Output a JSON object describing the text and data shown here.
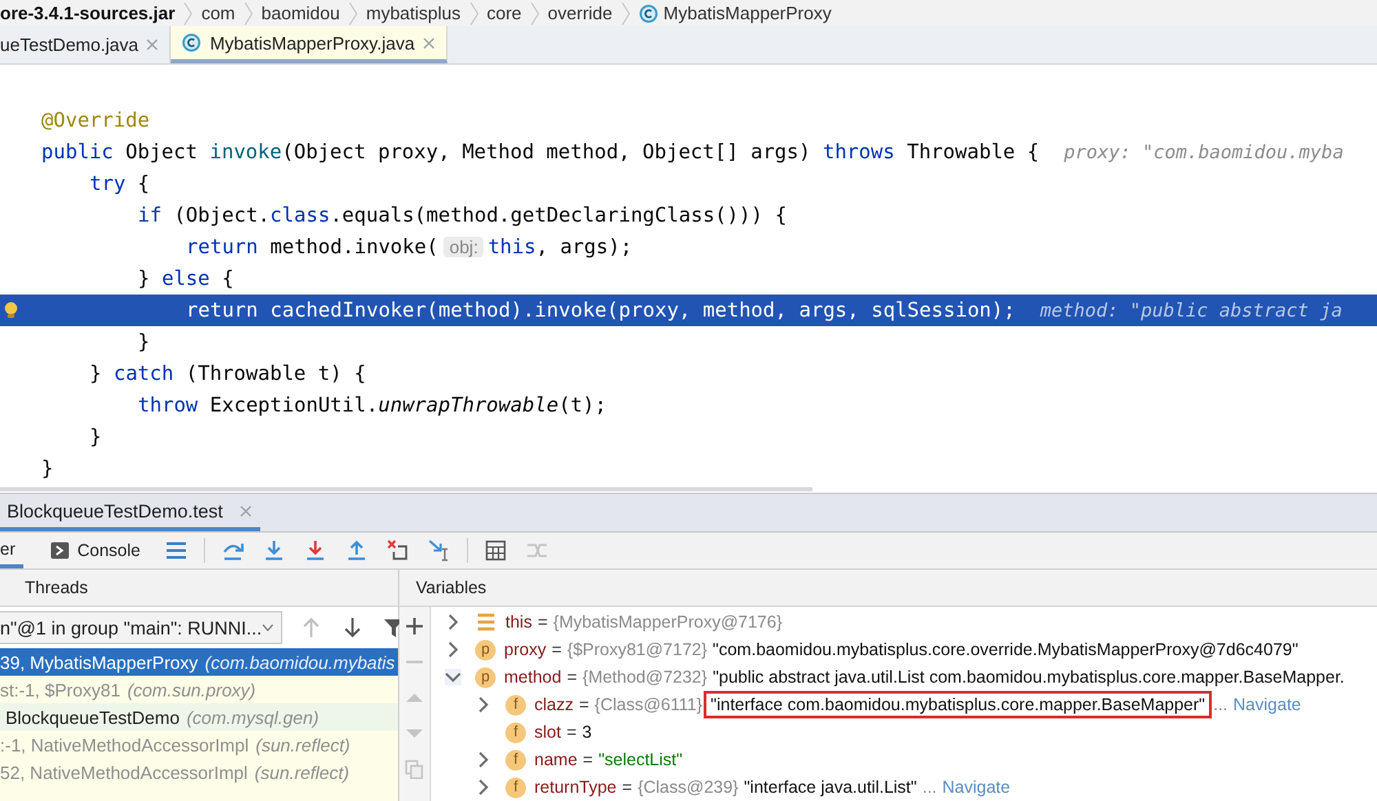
{
  "breadcrumb": [
    {
      "label": "ore-3.4.1-sources.jar",
      "kind": "jar"
    },
    {
      "label": "com",
      "kind": "package"
    },
    {
      "label": "baomidou",
      "kind": "package"
    },
    {
      "label": "mybatisplus",
      "kind": "package"
    },
    {
      "label": "core",
      "kind": "package"
    },
    {
      "label": "override",
      "kind": "package"
    },
    {
      "label": "MybatisMapperProxy",
      "kind": "class"
    }
  ],
  "editor_tabs": [
    {
      "label": "ueTestDemo.java",
      "selected": false,
      "kind": "plain"
    },
    {
      "label": "MybatisMapperProxy.java",
      "selected": true,
      "kind": "class"
    }
  ],
  "code_lines": [
    {
      "current": false,
      "segments": [
        {
          "kind": "annotation",
          "text": "@Override"
        }
      ]
    },
    {
      "current": false,
      "segments": [
        {
          "kind": "keyword",
          "text": "public"
        },
        {
          "kind": "plain",
          "text": " Object "
        },
        {
          "kind": "declaration",
          "text": "invoke"
        },
        {
          "kind": "plain",
          "text": "(Object proxy, Method method, Object[] args) "
        },
        {
          "kind": "keyword",
          "text": "throws"
        },
        {
          "kind": "plain",
          "text": " Throwable {"
        },
        {
          "kind": "debug_value",
          "text": "proxy: \"com.baomidou.myba"
        }
      ],
      "children": [
        {
          "current": false,
          "segments": [
            {
              "kind": "keyword",
              "text": "try"
            },
            {
              "kind": "plain",
              "text": " {"
            }
          ],
          "children": [
            {
              "current": false,
              "segments": [
                {
                  "kind": "keyword",
                  "text": "if"
                },
                {
                  "kind": "plain",
                  "text": " (Object."
                },
                {
                  "kind": "keyword",
                  "text": "class"
                },
                {
                  "kind": "plain",
                  "text": ".equals(method.getDeclaringClass())) {"
                }
              ],
              "children": [
                {
                  "current": false,
                  "segments": [
                    {
                      "kind": "keyword",
                      "text": "return"
                    },
                    {
                      "kind": "plain",
                      "text": " method.invoke("
                    },
                    {
                      "kind": "param_hint",
                      "text": "obj:"
                    },
                    {
                      "kind": "keyword",
                      "text": "this"
                    },
                    {
                      "kind": "plain",
                      "text": ", args);"
                    }
                  ]
                }
              ]
            },
            {
              "current": false,
              "segments": [
                {
                  "kind": "plain",
                  "text": "} "
                },
                {
                  "kind": "keyword",
                  "text": "else"
                },
                {
                  "kind": "plain",
                  "text": " {"
                }
              ],
              "children": [
                {
                  "current": true,
                  "segments": [
                    {
                      "kind": "keyword",
                      "text": "return"
                    },
                    {
                      "kind": "plain",
                      "text": " cachedInvoker(method).invoke(proxy, method, args, sqlSession);"
                    },
                    {
                      "kind": "debug_value",
                      "text": "method: \"public abstract ja"
                    }
                  ]
                }
              ]
            },
            {
              "current": false,
              "segments": [
                {
                  "kind": "plain",
                  "text": "}"
                }
              ]
            }
          ]
        },
        {
          "current": false,
          "segments": [
            {
              "kind": "plain",
              "text": "} "
            },
            {
              "kind": "keyword",
              "text": "catch"
            },
            {
              "kind": "plain",
              "text": " (Throwable t) {"
            }
          ],
          "children": [
            {
              "current": false,
              "segments": [
                {
                  "kind": "keyword",
                  "text": "throw"
                },
                {
                  "kind": "plain",
                  "text": " ExceptionUtil."
                },
                {
                  "kind": "italic",
                  "text": "unwrapThrowable"
                },
                {
                  "kind": "plain",
                  "text": "(t);"
                }
              ]
            }
          ]
        },
        {
          "current": false,
          "segments": [
            {
              "kind": "plain",
              "text": "}"
            }
          ]
        }
      ]
    },
    {
      "current": false,
      "segments": [
        {
          "kind": "plain",
          "text": "}"
        }
      ]
    }
  ],
  "debug_session_tab": {
    "label": "BlockqueueTestDemo.test",
    "selected": true
  },
  "debug_tabs": [
    {
      "label": "er",
      "selected": true,
      "kind": "plain"
    },
    {
      "label": "Console",
      "selected": false,
      "kind": "console"
    }
  ],
  "toolbar": [
    {
      "kind": "list"
    },
    {
      "kind": "separator"
    },
    {
      "kind": "step_over"
    },
    {
      "kind": "step_into"
    },
    {
      "kind": "force_step_into"
    },
    {
      "kind": "step_out"
    },
    {
      "kind": "drop_frame"
    },
    {
      "kind": "run_to_cursor"
    },
    {
      "kind": "separator"
    },
    {
      "kind": "evaluate"
    },
    {
      "kind": "trace"
    }
  ],
  "threads": {
    "title": "Threads",
    "selector": "n\"@1 in group \"main\": RUNNI...",
    "frames": [
      {
        "location": "39, MybatisMapperProxy",
        "package": "(com.baomidou.mybatis",
        "selected": true,
        "library": false
      },
      {
        "location": "st:-1, $Proxy81",
        "package": "(com.sun.proxy)",
        "selected": false,
        "library": true
      },
      {
        "location": "BlockqueueTestDemo",
        "package": "(com.mysql.gen)",
        "selected": false,
        "library": false
      },
      {
        "location": ":-1, NativeMethodAccessorImpl",
        "package": "(sun.reflect)",
        "selected": false,
        "library": true
      },
      {
        "location": "52, NativeMethodAccessorImpl",
        "package": "(sun.reflect)",
        "selected": false,
        "library": true
      }
    ]
  },
  "variables": {
    "title": "Variables",
    "items": [
      {
        "kind": "list",
        "name": "this",
        "operator": "=",
        "ref": "{MybatisMapperProxy@7176}",
        "expandable": true,
        "expanded": false
      },
      {
        "kind": "badge",
        "badge": "p",
        "name": "proxy",
        "operator": "=",
        "ref": "{$Proxy81@7172}",
        "value": "\"com.baomidou.mybatisplus.core.override.MybatisMapperProxy@7d6c4079\"",
        "string_value": false,
        "expandable": true,
        "expanded": false
      },
      {
        "kind": "badge",
        "badge": "p",
        "name": "method",
        "operator": "=",
        "ref": "{Method@7232}",
        "value": "\"public abstract java.util.List com.baomidou.mybatisplus.core.mapper.BaseMapper.",
        "string_value": false,
        "expandable": true,
        "expanded": true,
        "children": [
          {
            "kind": "badge",
            "badge": "f",
            "name": "clazz",
            "operator": "=",
            "ref": "{Class@6111}",
            "value": "\"interface com.baomidou.mybatisplus.core.mapper.BaseMapper\"",
            "string_value": false,
            "marked": true,
            "more": "...",
            "link": "Navigate",
            "expandable": true
          },
          {
            "kind": "badge",
            "badge": "f",
            "name": "slot",
            "operator": "=",
            "value": "3",
            "string_value": false,
            "expandable": false
          },
          {
            "kind": "badge",
            "badge": "f",
            "name": "name",
            "operator": "=",
            "value": "\"selectList\"",
            "string_value": true,
            "expandable": true
          },
          {
            "kind": "badge",
            "badge": "f",
            "name": "returnType",
            "operator": "=",
            "ref": "{Class@239}",
            "value": "\"interface java.util.List\"",
            "string_value": false,
            "more": "...",
            "link": "Navigate",
            "expandable": true
          }
        ]
      }
    ]
  }
}
